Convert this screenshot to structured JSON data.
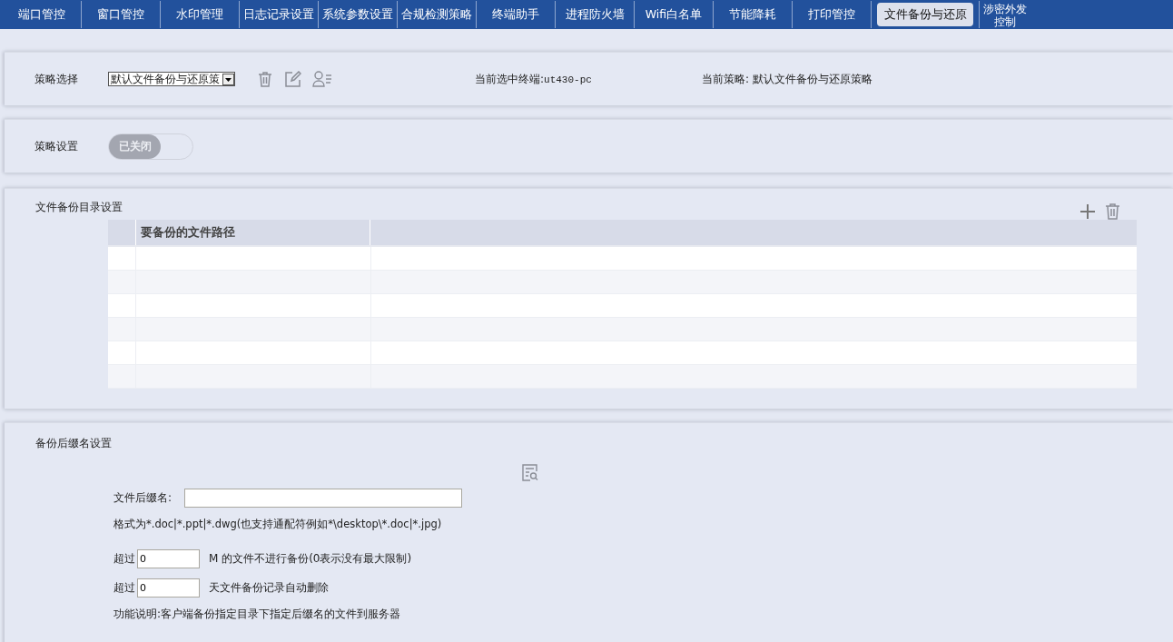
{
  "nav_tabs": [
    {
      "label": "端口管控",
      "selected": false
    },
    {
      "label": "窗口管控",
      "selected": false
    },
    {
      "label": "水印管理",
      "selected": false
    },
    {
      "label": "日志记录设置",
      "selected": false
    },
    {
      "label": "系统参数设置",
      "selected": false
    },
    {
      "label": "合规检测策略",
      "selected": false
    },
    {
      "label": "终端助手",
      "selected": false
    },
    {
      "label": "进程防火墙",
      "selected": false
    },
    {
      "label": "Wifi白名单",
      "selected": false
    },
    {
      "label": "节能降耗",
      "selected": false
    },
    {
      "label": "打印管控",
      "selected": false
    },
    {
      "label": "文件备份与还原",
      "selected": true
    },
    {
      "label": "涉密外发控制",
      "selected": false
    }
  ],
  "policy_select": {
    "label": "策略选择",
    "value": "默认文件备份与还原策",
    "current_terminal_label": "当前选中终端:",
    "current_terminal": "ut430-pc",
    "current_policy_label": "当前策略:",
    "current_policy": "默认文件备份与还原策略"
  },
  "policy_setting": {
    "label": "策略设置",
    "toggle": {
      "on": false,
      "text": "已关闭"
    }
  },
  "backup_dirs": {
    "title": "文件备份目录设置",
    "columns": [
      "要备份的文件路径"
    ]
  },
  "suffix_settings": {
    "title": "备份后缀名设置",
    "suffix_label": "文件后缀名:",
    "format_hint": "格式为*.doc|*.ppt|*.dwg(也支持通配符例如*\\desktop\\*.doc|*.jpg)",
    "size_prefix": "超过",
    "size_value": "0",
    "size_suffix": "M 的文件不进行备份(0表示没有最大限制)",
    "days_prefix": "超过",
    "days_value": "0",
    "days_suffix": "天文件备份记录自动删除",
    "description": "功能说明:客户端备份指定目录下指定后缀名的文件到服务器"
  }
}
